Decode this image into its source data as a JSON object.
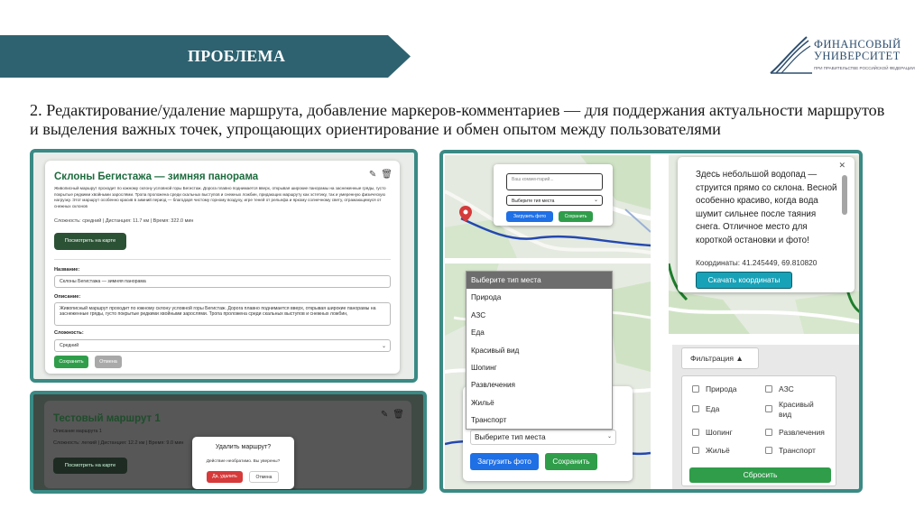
{
  "header": {
    "title": "ПРОБЛЕМА",
    "banner_color": "#2e6270"
  },
  "logo": {
    "name_line1": "ФИНАНСОВЫЙ",
    "name_line2": "УНИВЕРСИТЕТ",
    "subtitle": "ПРИ ПРАВИТЕЛЬСТВЕ РОССИЙСКОЙ ФЕДЕРАЦИИ"
  },
  "lead_text": "2. Редактирование/удаление маршрута, добавление маркеров-комментариев — для поддержания актуальности маршрутов и выделения важных точек, упрощающих ориентирование и обмен опытом между пользователями",
  "edit_route": {
    "title": "Склоны Бегистажа — зимняя панорама",
    "description": "Живописный маршрут проходит по южному склону условной горы Бегистаж. Дорога плавно поднимается вверх, открывая широкие панорамы на заснеженные гряды, густо покрытые редкими хвойными зарослями. Тропа проложена среди скальных выступов и снежных ложбин, придающих маршруту как эстетику, так и умеренную физическую нагрузку. Этот маршрут особенно красив в зимний период — благодаря чистому горному воздуху, игре теней от рельефа и яркому солнечному свету, отражающемуся от снежных склонов",
    "meta": "Сложность: средний | Дистанция: 11.7 км | Время: 322.0 мин",
    "map_button": "Посмотреть на карте",
    "name_label": "Название:",
    "name_value": "Склоны Бегистажа — зимняя панорама",
    "desc_label": "Описание:",
    "desc_value": "Живописный маршрут проходит по южному склону условной горы Бегистаж. Дорога плавно поднимается вверх, открывая широкие панорамы на заснеженные гряды, густо покрытые редкими хвойными зарослями. Тропа проложена среди скальных выступов и снежных ложбин,",
    "difficulty_label": "Сложность:",
    "difficulty_value": "Средний",
    "save_button": "Сохранить",
    "cancel_button": "Отмена",
    "edit_icon": "edit-icon",
    "delete_icon": "trash-icon"
  },
  "delete_route": {
    "title": "Тестовый маршрут 1",
    "subtitle": "Описание маршрута 1",
    "meta": "Сложность: легкий | Дистанция: 12.2 км | Время: 9.0 мин",
    "map_button": "Посмотреть на карте",
    "dialog_title": "Удалить маршрут?",
    "dialog_message": "Действие необратимо. Вы уверены?",
    "confirm_button": "Да, удалить",
    "cancel_button": "Отмена"
  },
  "comment_popup": {
    "placeholder": "Ваш комментарий...",
    "select_value": "Выберите тип места",
    "upload_button": "Загрузить фото",
    "save_button": "Сохранить"
  },
  "info_popup": {
    "text": "Здесь небольшой водопад — струится прямо со склона. Весной особенно красиво, когда вода шумит сильнее после таяния снега. Отличное место для короткой остановки и фото!",
    "coords": "Координаты: 41.245449, 69.810820",
    "copy_button": "Скачать координаты",
    "close_icon": "close-icon"
  },
  "place_type": {
    "options": [
      "Выберите тип места",
      "Природа",
      "АЗС",
      "Еда",
      "Красивый вид",
      "Шопинг",
      "Развлечения",
      "Жильё",
      "Транспорт"
    ],
    "selected": "Выберите тип места",
    "upload_button": "Загрузить фото",
    "save_button": "Сохранить"
  },
  "filter": {
    "header": "Фильтрация ▲",
    "options": [
      "Природа",
      "АЗС",
      "Еда",
      "Красивый вид",
      "Шопинг",
      "Развлечения",
      "Жильё",
      "Транспорт"
    ],
    "reset_button": "Сбросить"
  },
  "colors": {
    "frame": "#3a8a85",
    "green": "#2f9d4a",
    "blue": "#1f6fe5",
    "teal": "#17a2b8",
    "red": "#d63a3a"
  }
}
